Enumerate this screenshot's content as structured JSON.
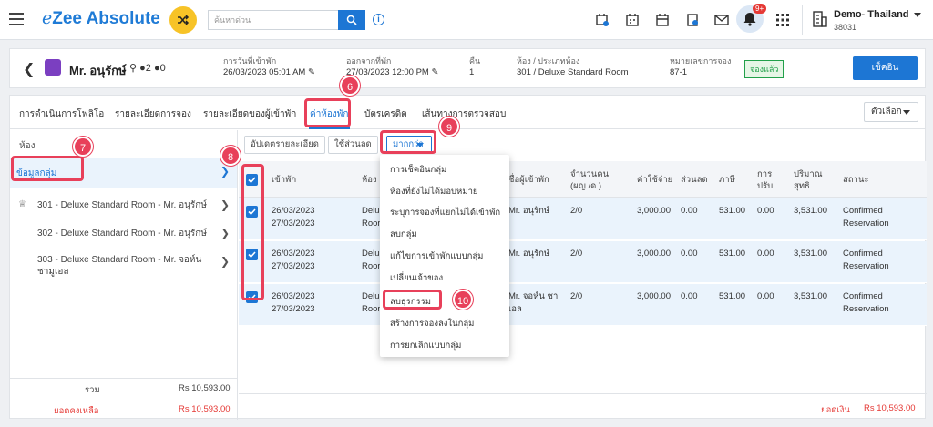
{
  "app": {
    "title": "eZee Absolute",
    "title_prefix": "e",
    "title_rest": "Zee Absolute"
  },
  "search": {
    "placeholder": "ค้นหาด่วน"
  },
  "notifications": {
    "badge": "9+"
  },
  "hotel": {
    "name": "Demo- Thailand",
    "code": "38031"
  },
  "reservation": {
    "guest_name": "Mr. อนุรักษ์",
    "adults": "2",
    "children": "0",
    "arrival_label": "การวันที่เข้าพัก",
    "arrival_value": "26/03/2023 05:01 AM",
    "departure_label": "ออกจากที่พัก",
    "departure_value": "27/03/2023 12:00 PM",
    "nights_label": "คืน",
    "nights_value": "1",
    "room_label": "ห้อง / ประเภทห้อง",
    "room_value": "301 / Deluxe Standard Room",
    "res_no_label": "หมายเลขการจอง",
    "res_no_value": "87-1",
    "status": "จองแล้ว",
    "checkin_button": "เช็คอิน"
  },
  "tabs": [
    {
      "label": "การดำเนินการโฟลิโอ"
    },
    {
      "label": "รายละเอียดการจอง"
    },
    {
      "label": "รายละเอียดของผู้เข้าพัก"
    },
    {
      "label": "ค่าห้องพัก"
    },
    {
      "label": "บัตรเครดิต"
    },
    {
      "label": "เส้นทางการตรวจสอบ"
    }
  ],
  "options_button": "ตัวเลือก",
  "left": {
    "heading": "ห้อง",
    "group": "ข้อมูลกลุ่ม",
    "rooms": [
      {
        "label": "301 - Deluxe Standard Room - Mr. อนุรักษ์"
      },
      {
        "label": "302 - Deluxe Standard Room - Mr. อนุรักษ์"
      },
      {
        "label": "303 - Deluxe Standard Room - Mr. จอห์น ชามูเอล"
      }
    ],
    "total_label": "รวม",
    "total_value": "Rs 10,593.00",
    "balance_label": "ยอดคงเหลือ",
    "balance_value": "Rs 10,593.00"
  },
  "toolbar": {
    "update_detail": "อัปเดตรายละเอียด",
    "apply_discount": "ใช้ส่วนลด",
    "more": "มากกว่า"
  },
  "grid": {
    "headers": {
      "checkin": "เข้าพัก",
      "room": "ห้อง",
      "guest": "ชื่อผู้เข้าพัก",
      "pax_1": "จำนวนคน",
      "pax_2": "(ผญ./ด.)",
      "charge": "ค่าใช้จ่าย",
      "discount": "ส่วนลด",
      "tax": "ภาษี",
      "adjust_1": "การ",
      "adjust_2": "ปรับ",
      "net_1": "ปริมาณ",
      "net_2": "สุทธิ",
      "status": "สถานะ"
    },
    "rows": [
      {
        "date1": "26/03/2023",
        "date2": "27/03/2023",
        "room1": "Delu",
        "room2": "Roor",
        "guest1": "Mr. อนุรักษ์",
        "guest2": "",
        "pax": "2/0",
        "charge": "3,000.00",
        "discount": "0.00",
        "tax": "531.00",
        "adjust": "0.00",
        "net": "3,531.00",
        "status1": "Confirmed",
        "status2": "Reservation"
      },
      {
        "date1": "26/03/2023",
        "date2": "27/03/2023",
        "room1": "Delu",
        "room2": "Roor",
        "guest1": "Mr. อนุรักษ์",
        "guest2": "",
        "pax": "2/0",
        "charge": "3,000.00",
        "discount": "0.00",
        "tax": "531.00",
        "adjust": "0.00",
        "net": "3,531.00",
        "status1": "Confirmed",
        "status2": "Reservation"
      },
      {
        "date1": "26/03/2023",
        "date2": "27/03/2023",
        "room1": "Delu",
        "room2": "Roor",
        "guest1": "Mr. จอห์น ชา",
        "guest2": "เอล",
        "pax": "2/0",
        "charge": "3,000.00",
        "discount": "0.00",
        "tax": "531.00",
        "adjust": "0.00",
        "net": "3,531.00",
        "status1": "Confirmed",
        "status2": "Reservation"
      }
    ],
    "footer_label": "ยอดเงิน",
    "footer_value": "Rs 10,593.00"
  },
  "dropdown": [
    {
      "label": "การเช็คอินกลุ่ม"
    },
    {
      "label": "ห้องที่ยังไม่ได้มอบหมาย"
    },
    {
      "label": "ระบุการจองที่แยกไม่ได้เข้าพัก"
    },
    {
      "label": "ลบกลุ่ม"
    },
    {
      "label": "แก้ไขการเข้าพักแบบกลุ่ม"
    },
    {
      "label": "เปลี่ยนเจ้าของ"
    },
    {
      "label": "ลบธุรกรรม"
    },
    {
      "label": "สร้างการจองลงในกลุ่ม"
    },
    {
      "label": "การยกเลิกแบบกลุ่ม"
    }
  ],
  "markers": {
    "m6": "6",
    "m7": "7",
    "m8": "8",
    "m9": "9",
    "m10": "10"
  },
  "colors": {
    "accent": "#1d76d4",
    "marker": "#e8405a",
    "status_green": "#22a04a",
    "balance_red": "#e53935"
  }
}
